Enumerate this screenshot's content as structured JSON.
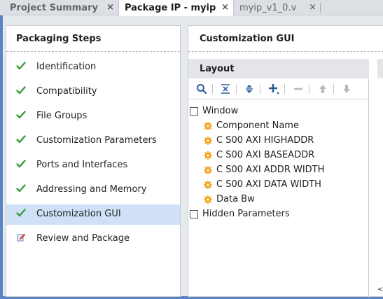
{
  "tabs": [
    {
      "label": "Project Summary",
      "close": "×"
    },
    {
      "label": "Package IP - myip",
      "close": "×"
    },
    {
      "label": "myip_v1_0.v",
      "close": "×"
    }
  ],
  "left_panel": {
    "title": "Packaging Steps",
    "steps": [
      {
        "label": "Identification",
        "icon": "check-icon"
      },
      {
        "label": "Compatibility",
        "icon": "check-icon"
      },
      {
        "label": "File Groups",
        "icon": "check-icon"
      },
      {
        "label": "Customization Parameters",
        "icon": "check-icon"
      },
      {
        "label": "Ports and Interfaces",
        "icon": "check-icon"
      },
      {
        "label": "Addressing and Memory",
        "icon": "check-icon"
      },
      {
        "label": "Customization GUI",
        "icon": "check-icon",
        "selected": true
      },
      {
        "label": "Review and Package",
        "icon": "edit-page-icon"
      }
    ]
  },
  "right_panel": {
    "title": "Customization GUI",
    "layout": {
      "title": "Layout",
      "toolbar": [
        "search-icon",
        "collapse-all-icon",
        "expand-all-icon",
        "add-icon",
        "remove-icon",
        "move-up-icon",
        "move-down-icon"
      ],
      "tree": {
        "window": "Window",
        "items": [
          "Component Name",
          "C S00 AXI HIGHADDR",
          "C S00 AXI BASEADDR",
          "C S00 AXI ADDR WIDTH",
          "C S00 AXI DATA WIDTH",
          "Data Bw"
        ],
        "hidden": "Hidden Parameters"
      }
    }
  },
  "colors": {
    "accent": "#5a84c6",
    "check": "#3a9a3a",
    "gear": "#f0a010",
    "selected": "#cfe0f7"
  }
}
